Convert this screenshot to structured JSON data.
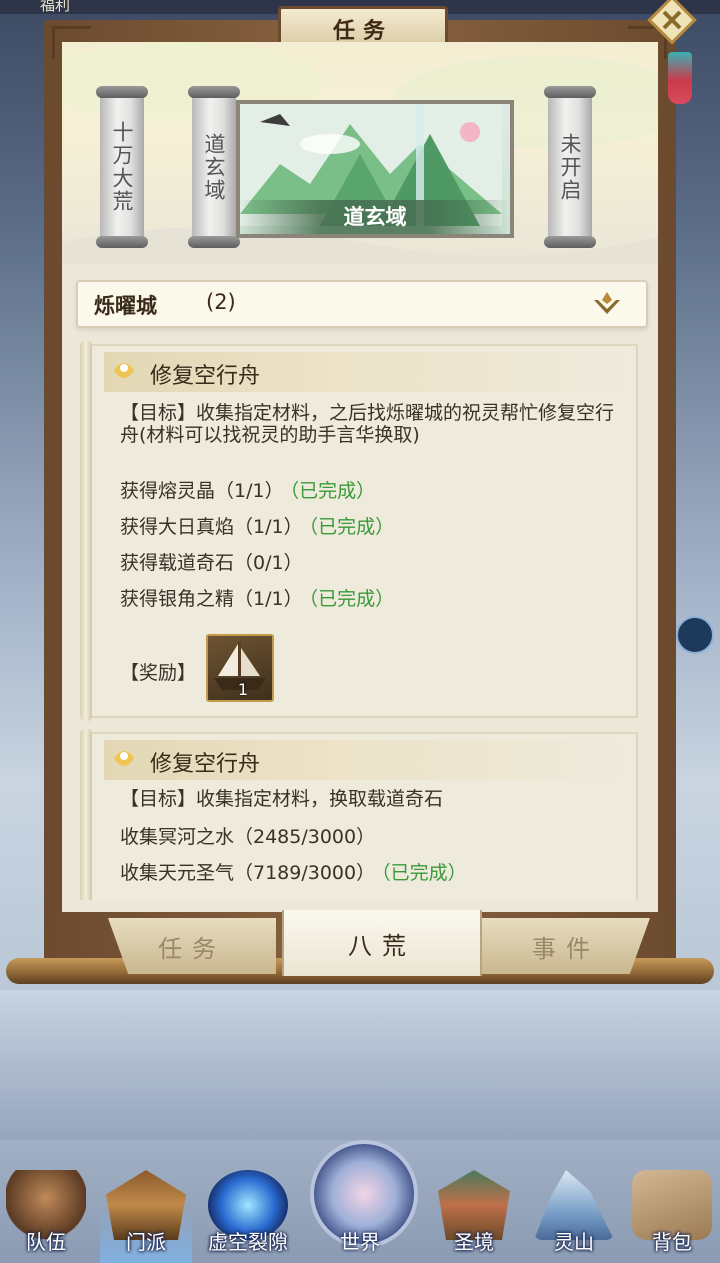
{
  "topbar": {
    "left_text": "福利"
  },
  "panel": {
    "title": "任务"
  },
  "regions": {
    "scrolls": [
      {
        "label": "十万大荒"
      },
      {
        "label": "道玄域"
      },
      {
        "label": "未开启"
      }
    ],
    "selected": {
      "label": "道玄域"
    }
  },
  "city": {
    "name": "烁曜城",
    "count": "(2)"
  },
  "quests": [
    {
      "title": "修复空行舟",
      "goal": "【目标】收集指定材料，之后找烁曜城的祝灵帮忙修复空行舟(材料可以找祝灵的助手言华换取)",
      "objectives": [
        {
          "text": "获得熔灵晶（1/1）",
          "status": "（已完成）"
        },
        {
          "text": "获得大日真焰（1/1）",
          "status": "（已完成）"
        },
        {
          "text": "获得载道奇石（0/1）",
          "status": ""
        },
        {
          "text": "获得银角之精（1/1）",
          "status": "（已完成）"
        }
      ],
      "reward_label": "【奖励】",
      "reward_qty": "1"
    },
    {
      "title": "修复空行舟",
      "goal": "【目标】收集指定材料，换取载道奇石",
      "objectives": [
        {
          "text": "收集冥河之水（2485/3000）",
          "status": ""
        },
        {
          "text": "收集天元圣气（7189/3000）",
          "status": "（已完成）"
        }
      ]
    }
  ],
  "tabs": [
    {
      "label": "任务",
      "active": false
    },
    {
      "label": "八荒",
      "active": true
    },
    {
      "label": "事件",
      "active": false
    }
  ],
  "bottom_nav": [
    {
      "label": "队伍",
      "icon": "team-icon"
    },
    {
      "label": "门派",
      "icon": "sect-icon",
      "selected": true
    },
    {
      "label": "虚空裂隙",
      "icon": "void-rift-icon"
    },
    {
      "label": "世界",
      "icon": "world-icon"
    },
    {
      "label": "圣境",
      "icon": "holy-realm-icon"
    },
    {
      "label": "灵山",
      "icon": "spirit-mountain-icon"
    },
    {
      "label": "背包",
      "icon": "backpack-icon"
    }
  ],
  "colors": {
    "done": "#3a9a3a",
    "frame": "#6b4a2e",
    "paper": "#ece7d8"
  }
}
